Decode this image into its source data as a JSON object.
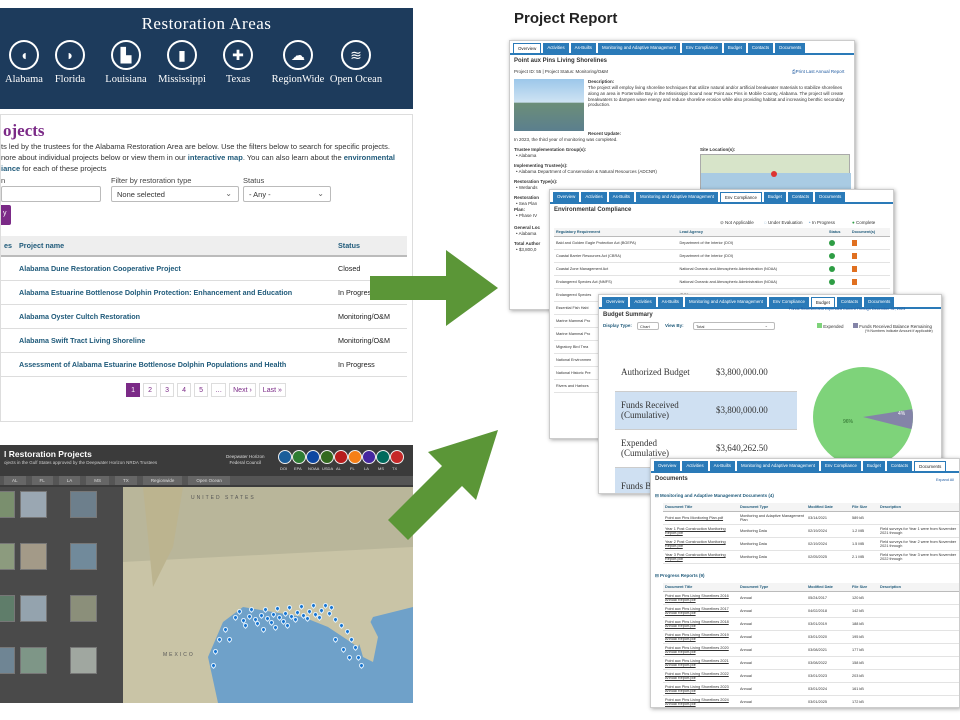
{
  "restoration_areas": {
    "title": "Restoration Areas",
    "states": [
      {
        "label": "Alabama",
        "icon": "alabama-state-icon",
        "glyph": "◖"
      },
      {
        "label": "Florida",
        "icon": "florida-state-icon",
        "glyph": "◗"
      },
      {
        "label": "Louisiana",
        "icon": "louisiana-state-icon",
        "glyph": "▙"
      },
      {
        "label": "Mississippi",
        "icon": "mississippi-state-icon",
        "glyph": "▮"
      },
      {
        "label": "Texas",
        "icon": "texas-state-icon",
        "glyph": "✚"
      },
      {
        "label": "RegionWide",
        "icon": "regionwide-icon",
        "glyph": "☁"
      },
      {
        "label": "Open Ocean",
        "icon": "open-ocean-icon",
        "glyph": "≋"
      }
    ]
  },
  "projects_page": {
    "heading": "ojects",
    "desc_1": "ts led by the trustees for the Alabama Restoration Area are below. Use the filters below to search for specific projects.",
    "desc_2a": "nore about individual projects below or view them in our ",
    "desc_2_link": "interactive map",
    "desc_2b": ". You can also learn about the ",
    "desc_2_link2": "environmental",
    "desc_3_link": "iance",
    "desc_3": " for each of these projects",
    "filter_type_label": "Filter by restoration type",
    "filter_type_value": "None selected",
    "status_label": "Status",
    "status_value": "- Any -",
    "col_left": "es",
    "col_name": "Project name",
    "col_status": "Status",
    "rows": [
      {
        "name": "Alabama Dune Restoration Cooperative Project",
        "status": "Closed"
      },
      {
        "name": "Alabama Estuarine Bottlenose Dolphin Protection: Enhancement and Education",
        "status": "In Progress"
      },
      {
        "name": "Alabama Oyster Cultch Restoration",
        "status": "Monitoring/O&M"
      },
      {
        "name": "Alabama Swift Tract Living Shoreline",
        "status": "Monitoring/O&M"
      },
      {
        "name": "Assessment of Alabama Estuarine Bottlenose Dolphin Populations and Health",
        "status": "In Progress"
      }
    ],
    "pager": [
      "1",
      "2",
      "3",
      "4",
      "5",
      "…",
      "Next ›",
      "Last »"
    ]
  },
  "map_panel": {
    "title": "l Restoration Projects",
    "subtitle": "ojects in the Gulf States approved by the Deepwater Horizon NRDA Trustees",
    "org": "Deepwater Horizon\nFederal Council",
    "tabs": [
      "AL",
      "FL",
      "LA",
      "MS",
      "TX",
      "Regionwide",
      "Open Ocean"
    ],
    "logos": [
      "DOI",
      "EPA",
      "NOAA",
      "USDA",
      "AL",
      "FL",
      "LA",
      "MS",
      "TX"
    ],
    "map_labels": [
      "UNITED STATES",
      "MEXICO"
    ]
  },
  "report": {
    "title": "Project Report",
    "tabs": [
      "Overview",
      "Activities",
      "As-Builts",
      "Monitoring and Adaptive Management",
      "Env Compliance",
      "Budget",
      "Contacts",
      "Documents"
    ],
    "overview": {
      "project_name": "Point aux Pins Living Shorelines",
      "id_line": "Project ID: 55 | Project Status: Monitoring/O&M",
      "print_link": "Print Last Annual Report",
      "desc_head": "Description:",
      "desc": "The project will employ living shoreline techniques that utilize natural and/or artificial breakwater materials to stabilize shorelines along an area in Portersville Bay in the Mississippi Sound near Point aux Pins in Mobile County, Alabama. The project will create breakwaters to dampen wave energy and reduce shoreline erosion while also providing habitat and increasing benthic secondary production.",
      "update_head": "Recent Update:",
      "update": "In 2023, the third year of monitoring was completed.",
      "tig_head": "Trustee Implementation Group(s):",
      "tig": "• Alabama",
      "site_head": "Site Location(s):",
      "impl_head": "Implementing Trustee(s):",
      "impl": "• Alabama Department of Conservation & Natural Resources (ADCNR)",
      "rtype_head": "Restoration Type(s):",
      "rtype": "• Wetlands",
      "side_labels": [
        "Restoration",
        "Plan:",
        "General Loc",
        "Total Author"
      ],
      "side_values": [
        "• Sea Plan",
        "• Phase IV",
        "• Alabama",
        "• $3,800,0"
      ]
    },
    "env": {
      "title": "Environmental Compliance",
      "legend": [
        "Not Applicable",
        "Under Evaluation",
        "In Progress",
        "Complete"
      ],
      "headers": [
        "Regulatory Requirement",
        "Lead Agency",
        "Status",
        "Document(s)"
      ],
      "rows": [
        {
          "req": "Bald and Golden Eagle Protection Act (BGEPA)",
          "agency": "Department of the Interior (DOI)"
        },
        {
          "req": "Coastal Barrier Resources Act (CBRA)",
          "agency": "Department of the Interior (DOI)"
        },
        {
          "req": "Coastal Zone Management Act",
          "agency": "National Oceanic and Atmospheric Administration (NOAA)"
        },
        {
          "req": "Endangered Species Act (NMFS)",
          "agency": "National Oceanic and Atmospheric Administration (NOAA)"
        },
        {
          "req": "Endangered Species",
          "agency": "(DOI)"
        },
        {
          "req": "Essential Fish Habi",
          "agency": ""
        },
        {
          "req": "Marine Mammal Pro",
          "agency": ""
        },
        {
          "req": "Marine Mammal Pro",
          "agency": ""
        },
        {
          "req": "Migratory Bird Trea",
          "agency": ""
        },
        {
          "req": "National Environmen",
          "agency": ""
        },
        {
          "req": "National Historic Pre",
          "agency": ""
        },
        {
          "req": "Rivers and Harbors",
          "agency": ""
        }
      ]
    },
    "budget": {
      "title": "Budget Summary",
      "note": "Funds Received and Expended Current Through December 31, 2023",
      "display_type_label": "Display Type:",
      "display_type": "Chart",
      "view_label": "View By:",
      "view": "Total",
      "legend": [
        "Expended",
        "Funds Received Balance Remaining"
      ],
      "legend_sub": "(% Numbers indicate Amount if applicable)",
      "rows": [
        {
          "label": "Authorized Budget",
          "value": "$3,800,000.00"
        },
        {
          "label": "Funds Received (Cumulative)",
          "value": "$3,800,000.00"
        },
        {
          "label": "Expended (Cumulative)",
          "value": "$3,640,262.50"
        },
        {
          "label": "Funds Balan",
          "value": ""
        }
      ],
      "pie_labels": [
        "96%",
        "4%"
      ]
    },
    "documents": {
      "title": "Documents",
      "expand_all": "Expand All",
      "section1": "Monitoring and Adaptive Management Documents (4)",
      "headers": [
        "Document Title",
        "Document Type",
        "Modified Date",
        "File Size",
        "Description"
      ],
      "rows1": [
        {
          "title": "Point aux Pins Monitoring Plan.pdf",
          "type": "Monitoring and Adaptive Management Plan",
          "date": "03/14/2021",
          "size": "589 kB",
          "desc": ""
        },
        {
          "title": "Year 1 Post Construction Monitoring Report.pdf",
          "type": "Monitoring Data",
          "date": "02/19/2024",
          "size": "1.2 MB",
          "desc": "Field surveys for Year 1 were from November 2021 through"
        },
        {
          "title": "Year 2 Post Construction Monitoring Report.pdf",
          "type": "Monitoring Data",
          "date": "02/19/2024",
          "size": "1.5 MB",
          "desc": "Field surveys for Year 2 were from November 2021 through"
        },
        {
          "title": "Year 3 Post Construction Monitoring Report.pdf",
          "type": "Monitoring Data",
          "date": "02/05/2025",
          "size": "2.1 MB",
          "desc": "Field surveys for Year 3 were from November 2022 through"
        }
      ],
      "section2": "Progress Reports (9)",
      "rows2": [
        {
          "title": "Point aux Pins Living Shorelines 2016 Annual Report.pdf",
          "type": "Annual",
          "date": "05/24/2017",
          "size": "120 kB"
        },
        {
          "title": "Point aux Pins Living Shorelines 2017 Annual Report.pdf",
          "type": "Annual",
          "date": "04/02/2018",
          "size": "142 kB"
        },
        {
          "title": "Point aux Pins Living Shorelines 2018 Annual Report.pdf",
          "type": "Annual",
          "date": "03/01/2019",
          "size": "188 kB"
        },
        {
          "title": "Point aux Pins Living Shorelines 2019 Annual Report.pdf",
          "type": "Annual",
          "date": "03/01/2020",
          "size": "195 kB"
        },
        {
          "title": "Point aux Pins Living Shorelines 2020 Annual Report.pdf",
          "type": "Annual",
          "date": "03/08/2021",
          "size": "177 kB"
        },
        {
          "title": "Point aux Pins Living Shorelines 2021 Annual Report.pdf",
          "type": "Annual",
          "date": "03/08/2022",
          "size": "158 kB"
        },
        {
          "title": "Point aux Pins Living Shorelines 2022 Annual Report.pdf",
          "type": "Annual",
          "date": "03/01/2023",
          "size": "203 kB"
        },
        {
          "title": "Point aux Pins Living Shorelines 2023 Annual Report.pdf",
          "type": "Annual",
          "date": "03/01/2024",
          "size": "161 kB"
        },
        {
          "title": "Point aux Pins Living Shorelines 2024 Annual Report.pdf",
          "type": "Annual",
          "date": "03/01/2025",
          "size": "172 kB"
        }
      ]
    }
  },
  "colors": {
    "navy": "#1d3b5c",
    "purple": "#7b2a87",
    "arrow": "#5b9637",
    "tab_blue": "#2a7ab8",
    "pie_green": "#7ed37a",
    "pie_purple": "#8484a8"
  }
}
